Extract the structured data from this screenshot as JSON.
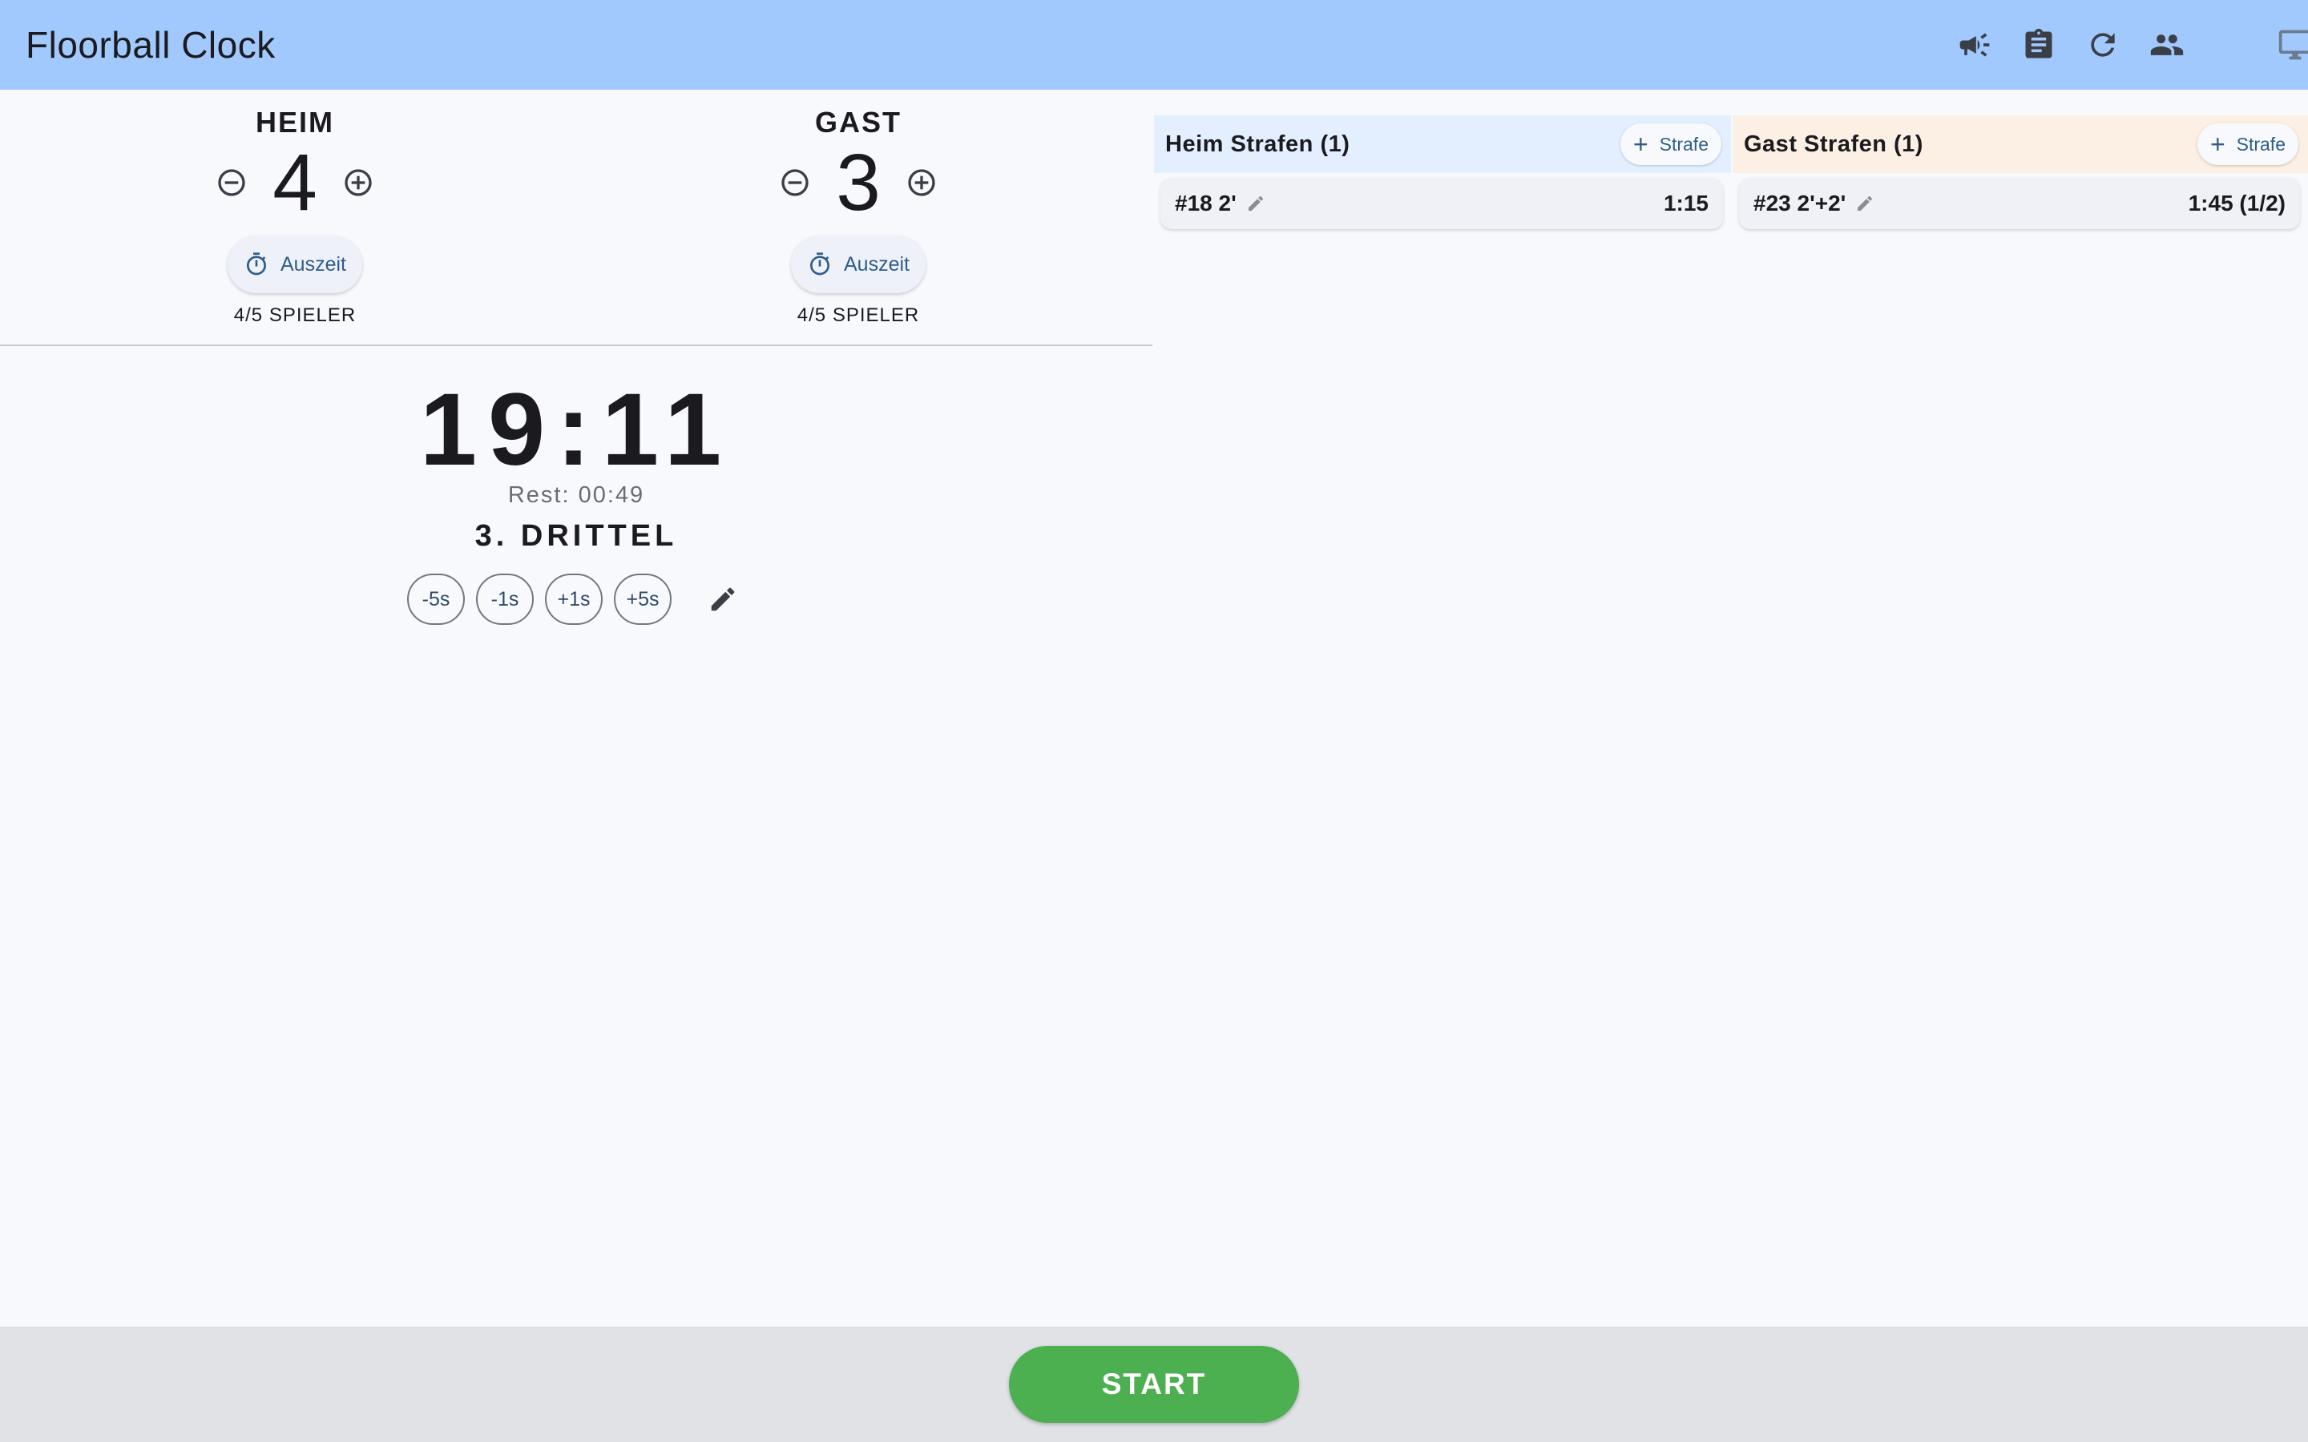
{
  "app": {
    "title": "Floorball Clock"
  },
  "toolbar": {
    "icons": [
      "megaphone-icon",
      "clipboard-icon",
      "refresh-icon",
      "people-icon",
      "monitor-icon"
    ]
  },
  "home": {
    "name": "HEIM",
    "score": "4",
    "timeout_label": "Auszeit",
    "players": "4/5 SPIELER"
  },
  "guest": {
    "name": "GAST",
    "score": "3",
    "timeout_label": "Auszeit",
    "players": "4/5 SPIELER"
  },
  "clock": {
    "time": "19:11",
    "rest": "Rest: 00:49",
    "period": "3. DRITTEL",
    "adjust": [
      "-5s",
      "-1s",
      "+1s",
      "+5s"
    ]
  },
  "penalties": {
    "home": {
      "title": "Heim Strafen (1)",
      "add_label": "Strafe",
      "items": [
        {
          "label": "#18 2'",
          "time": "1:15"
        }
      ]
    },
    "guest": {
      "title": "Gast Strafen (1)",
      "add_label": "Strafe",
      "items": [
        {
          "label": "#23 2'+2'",
          "time": "1:45 (1/2)"
        }
      ]
    }
  },
  "footer": {
    "start_label": "START"
  },
  "colors": {
    "appbar": "#a1c9fd",
    "home_header": "#e3efff",
    "guest_header": "#fcefe4",
    "start": "#4caf50"
  }
}
